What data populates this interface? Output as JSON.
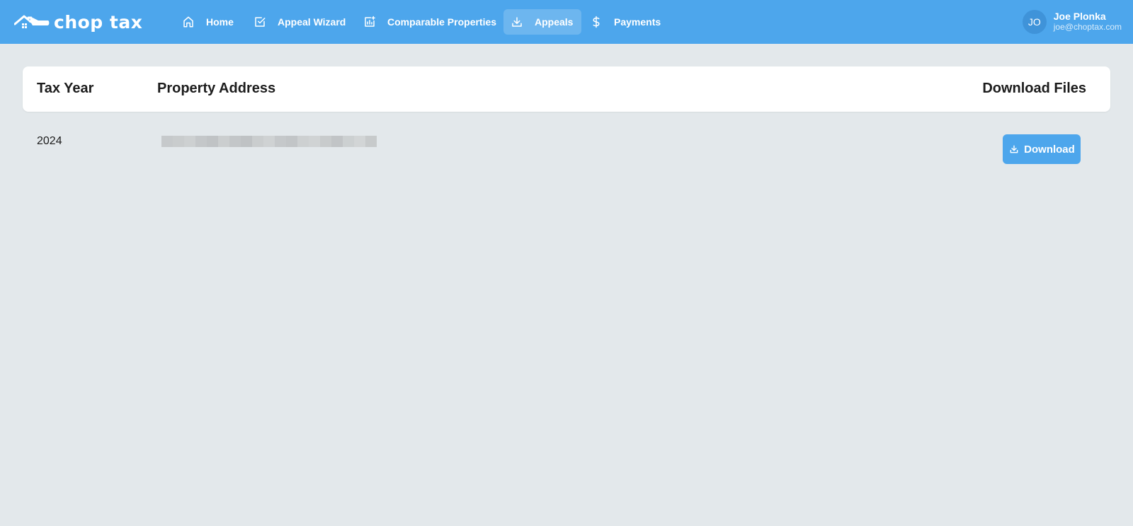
{
  "app": {
    "brand": "chop tax"
  },
  "nav": {
    "items": [
      {
        "label": "Home",
        "icon": "home-icon"
      },
      {
        "label": "Appeal Wizard",
        "icon": "checkbox-icon"
      },
      {
        "label": "Comparable Properties",
        "icon": "chart-add-icon"
      },
      {
        "label": "Appeals",
        "icon": "download-icon",
        "active": true
      },
      {
        "label": "Payments",
        "icon": "dollar-icon"
      }
    ]
  },
  "user": {
    "initials": "JO",
    "name": "Joe Plonka",
    "email": "joe@choptax.com"
  },
  "table": {
    "columns": [
      "Tax Year",
      "Property Address",
      "Download Files"
    ],
    "rows": [
      {
        "tax_year": "2024",
        "property_address": "",
        "action_label": "Download"
      }
    ]
  },
  "colors": {
    "brand": "#4da6ec",
    "background": "#e3e8eb",
    "card": "#ffffff"
  }
}
